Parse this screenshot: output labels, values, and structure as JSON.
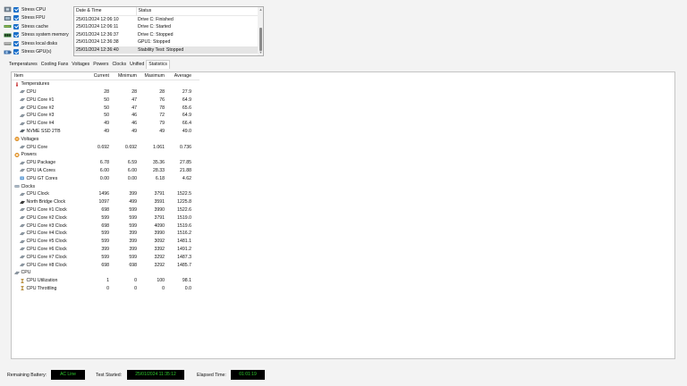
{
  "stress": [
    {
      "label": "Stress CPU",
      "icon": "cpu-chip-icon"
    },
    {
      "label": "Stress FPU",
      "icon": "fpu-chip-icon"
    },
    {
      "label": "Stress cache",
      "icon": "cache-icon"
    },
    {
      "label": "Stress system memory",
      "icon": "memory-module-icon"
    },
    {
      "label": "Stress local disks",
      "icon": "disk-icon"
    },
    {
      "label": "Stress GPU(s)",
      "icon": "gpu-icon"
    }
  ],
  "log": {
    "headers": {
      "date": "Date & Time",
      "status": "Status"
    },
    "rows": [
      {
        "date": "25/01/2024 12:06:10",
        "status": "Drive C: Finished"
      },
      {
        "date": "25/01/2024 12:06:11",
        "status": "Drive C: Started"
      },
      {
        "date": "25/01/2024 12:36:37",
        "status": "Drive C: Stopped"
      },
      {
        "date": "25/01/2024 12:36:38",
        "status": "GPU1: Stopped"
      },
      {
        "date": "25/01/2024 12:36:40",
        "status": "Stability Test: Stopped"
      }
    ]
  },
  "tabs": [
    "Temperatures",
    "Cooling Fans",
    "Voltages",
    "Powers",
    "Clocks",
    "Unified",
    "Statistics"
  ],
  "active_tab": "Statistics",
  "stats": {
    "headers": {
      "item": "Item",
      "current": "Current",
      "minimum": "Minimum",
      "maximum": "Maximum",
      "average": "Average"
    },
    "rows": [
      {
        "type": "group",
        "label": "Temperatures",
        "icon": "thermometer-icon"
      },
      {
        "type": "item",
        "label": "CPU",
        "icon": "cpu-icon",
        "v": [
          "28",
          "28",
          "28",
          "27.9"
        ]
      },
      {
        "type": "item",
        "label": "CPU Core #1",
        "icon": "cpu-icon",
        "v": [
          "50",
          "47",
          "76",
          "64.9"
        ]
      },
      {
        "type": "item",
        "label": "CPU Core #2",
        "icon": "cpu-icon",
        "v": [
          "50",
          "47",
          "78",
          "65.6"
        ]
      },
      {
        "type": "item",
        "label": "CPU Core #3",
        "icon": "cpu-icon",
        "v": [
          "50",
          "46",
          "72",
          "64.9"
        ]
      },
      {
        "type": "item",
        "label": "CPU Core #4",
        "icon": "cpu-icon",
        "v": [
          "49",
          "46",
          "79",
          "66.4"
        ]
      },
      {
        "type": "item",
        "label": "NVME SSD 2TB",
        "icon": "ssd-icon",
        "v": [
          "49",
          "49",
          "49",
          "49.0"
        ]
      },
      {
        "type": "group",
        "label": "Voltages",
        "icon": "voltage-icon"
      },
      {
        "type": "item",
        "label": "CPU Core",
        "icon": "cpu-icon",
        "v": [
          "0.692",
          "0.692",
          "1.061",
          "0.736"
        ]
      },
      {
        "type": "group",
        "label": "Powers",
        "icon": "power-icon"
      },
      {
        "type": "item",
        "label": "CPU Package",
        "icon": "cpu-icon",
        "v": [
          "6.78",
          "6.59",
          "35.36",
          "27.85"
        ]
      },
      {
        "type": "item",
        "label": "CPU IA Cores",
        "icon": "cpu-icon",
        "v": [
          "6.00",
          "6.00",
          "28.33",
          "21.88"
        ]
      },
      {
        "type": "item",
        "label": "CPU GT Cores",
        "icon": "gpu-core-icon",
        "v": [
          "0.00",
          "0.00",
          "6.18",
          "4.62"
        ]
      },
      {
        "type": "group",
        "label": "Clocks",
        "icon": "clock-icon"
      },
      {
        "type": "item",
        "label": "CPU Clock",
        "icon": "cpu-icon",
        "v": [
          "1496",
          "399",
          "3791",
          "1522.5"
        ]
      },
      {
        "type": "item",
        "label": "North Bridge Clock",
        "icon": "chipset-icon",
        "v": [
          "1097",
          "499",
          "3591",
          "1225.8"
        ]
      },
      {
        "type": "item",
        "label": "CPU Core #1 Clock",
        "icon": "cpu-icon",
        "v": [
          "698",
          "599",
          "3990",
          "1522.6"
        ]
      },
      {
        "type": "item",
        "label": "CPU Core #2 Clock",
        "icon": "cpu-icon",
        "v": [
          "599",
          "599",
          "3791",
          "1519.0"
        ]
      },
      {
        "type": "item",
        "label": "CPU Core #3 Clock",
        "icon": "cpu-icon",
        "v": [
          "698",
          "599",
          "4090",
          "1519.6"
        ]
      },
      {
        "type": "item",
        "label": "CPU Core #4 Clock",
        "icon": "cpu-icon",
        "v": [
          "599",
          "399",
          "3990",
          "1516.2"
        ]
      },
      {
        "type": "item",
        "label": "CPU Core #5 Clock",
        "icon": "cpu-icon",
        "v": [
          "599",
          "399",
          "3092",
          "1481.1"
        ]
      },
      {
        "type": "item",
        "label": "CPU Core #6 Clock",
        "icon": "cpu-icon",
        "v": [
          "399",
          "399",
          "3392",
          "1491.2"
        ]
      },
      {
        "type": "item",
        "label": "CPU Core #7 Clock",
        "icon": "cpu-icon",
        "v": [
          "599",
          "599",
          "3292",
          "1487.3"
        ]
      },
      {
        "type": "item",
        "label": "CPU Core #8 Clock",
        "icon": "cpu-icon",
        "v": [
          "698",
          "698",
          "3292",
          "1485.7"
        ]
      },
      {
        "type": "group",
        "label": "CPU",
        "icon": "cpu-icon"
      },
      {
        "type": "item",
        "label": "CPU Utilization",
        "icon": "hourglass-icon",
        "v": [
          "1",
          "0",
          "100",
          "98.1"
        ]
      },
      {
        "type": "item",
        "label": "CPU Throttling",
        "icon": "hourglass-icon",
        "v": [
          "0",
          "0",
          "0",
          "0.0"
        ]
      }
    ]
  },
  "footer": {
    "battery_label": "Remaining Battery:",
    "battery_value": "AC Line",
    "started_label": "Test Started:",
    "started_value": "25/01/2024 11:35:12",
    "elapsed_label": "Elapsed Time:",
    "elapsed_value": "01:01:19"
  }
}
